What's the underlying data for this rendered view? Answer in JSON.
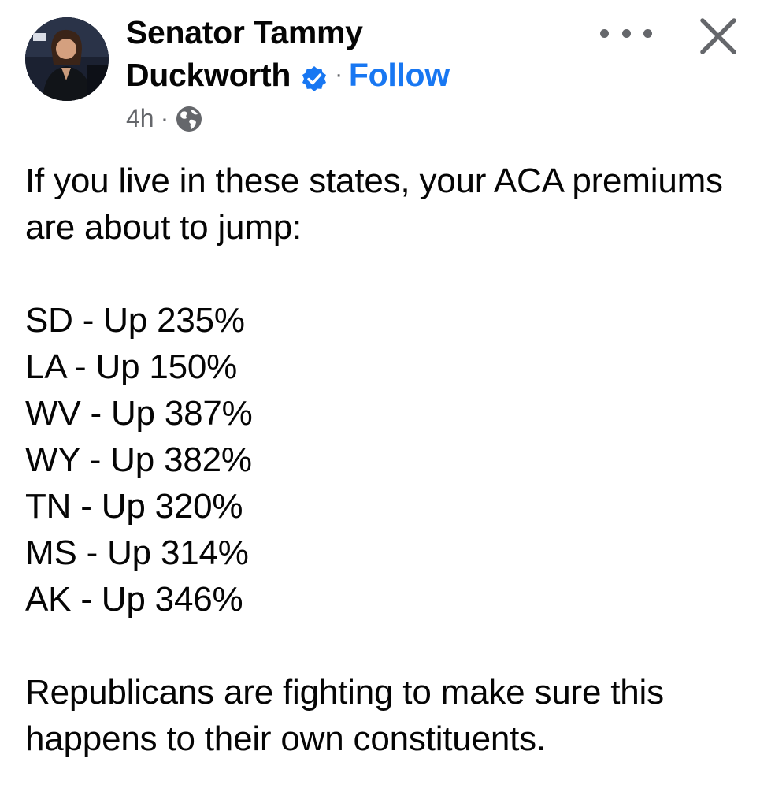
{
  "post": {
    "author_name_line1": "Senator Tammy",
    "author_name_line2": "Duckworth",
    "separator": "·",
    "follow_label": "Follow",
    "timestamp": "4h",
    "meta_separator": "·",
    "intro_text": "If you live in these states, your ACA premiums are about to jump:",
    "state_increases": [
      "SD - Up 235%",
      "LA - Up 150%",
      "WV - Up 387%",
      "WY - Up 382%",
      "TN - Up 320%",
      "MS - Up 314%",
      "AK - Up 346%"
    ],
    "closing_text": "Republicans are fighting to make sure this happens to their own constituents."
  },
  "icons": {
    "verified": "verified-badge-icon",
    "audience": "globe-icon",
    "more": "more-options-icon",
    "close": "close-icon"
  },
  "colors": {
    "link": "#1877f2",
    "text": "#050505",
    "secondary": "#65676b"
  }
}
